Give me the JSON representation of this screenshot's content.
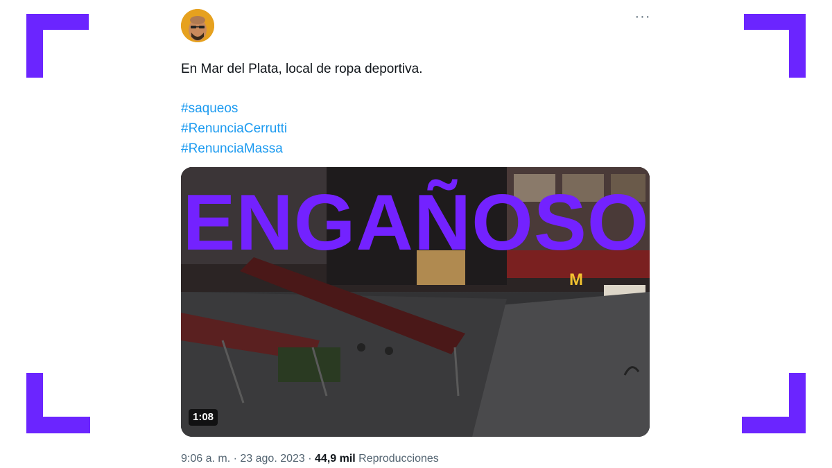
{
  "tweet": {
    "more_icon": "more-icon",
    "text": "En Mar del Plata, local de ropa deportiva.",
    "hashtags": [
      "#saqueos",
      "#RenunciaCerrutti",
      "#RenunciaMassa"
    ],
    "video": {
      "duration": "1:08"
    },
    "meta": {
      "time": "9:06 a. m.",
      "sep1": " · ",
      "date": "23 ago. 2023",
      "sep2": " · ",
      "views": "44,9 mil",
      "views_label": " Reproducciones"
    }
  },
  "overlay": {
    "stamp": "ENGAÑOSO",
    "accent_color": "#6b25ff"
  }
}
